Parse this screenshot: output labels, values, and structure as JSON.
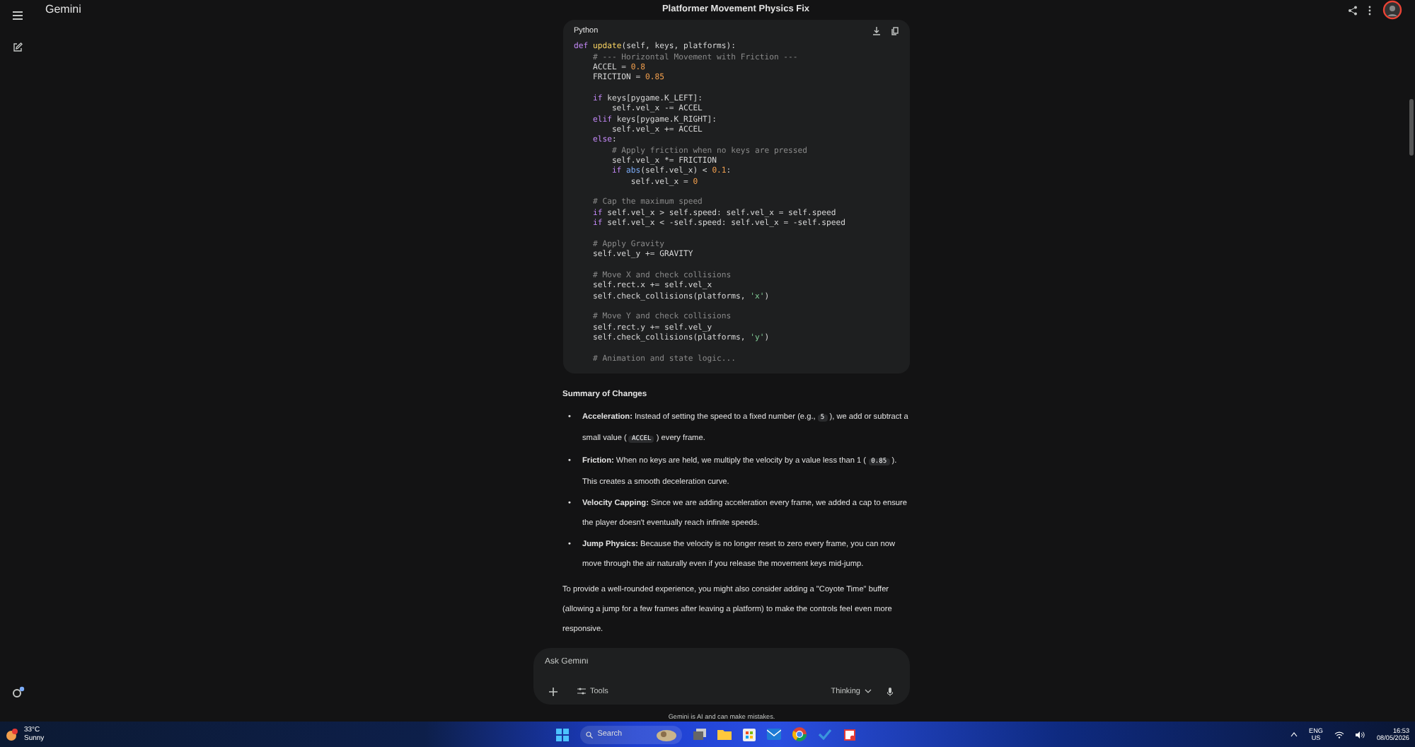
{
  "app": {
    "name": "Gemini"
  },
  "conversation": {
    "title": "Platformer Movement Physics Fix"
  },
  "code_block": {
    "language": "Python",
    "lines": [
      {
        "kind": "code",
        "tokens": [
          {
            "kind": "kw",
            "text": "def "
          },
          {
            "kind": "fn",
            "text": "update"
          },
          {
            "kind": "plain",
            "text": "(self, keys, platforms):"
          }
        ]
      },
      {
        "kind": "code",
        "tokens": [
          {
            "kind": "cm",
            "text": "    # --- Horizontal Movement with Friction ---"
          }
        ]
      },
      {
        "kind": "code",
        "tokens": [
          {
            "kind": "plain",
            "text": "    ACCEL = "
          },
          {
            "kind": "num",
            "text": "0.8"
          }
        ]
      },
      {
        "kind": "code",
        "tokens": [
          {
            "kind": "plain",
            "text": "    FRICTION = "
          },
          {
            "kind": "num",
            "text": "0.85"
          }
        ]
      },
      {
        "kind": "blank"
      },
      {
        "kind": "code",
        "tokens": [
          {
            "kind": "kw",
            "text": "    if"
          },
          {
            "kind": "plain",
            "text": " keys[pygame.K_LEFT]:"
          }
        ]
      },
      {
        "kind": "code",
        "tokens": [
          {
            "kind": "plain",
            "text": "        self.vel_x -= ACCEL"
          }
        ]
      },
      {
        "kind": "code",
        "tokens": [
          {
            "kind": "kw",
            "text": "    elif"
          },
          {
            "kind": "plain",
            "text": " keys[pygame.K_RIGHT]:"
          }
        ]
      },
      {
        "kind": "code",
        "tokens": [
          {
            "kind": "plain",
            "text": "        self.vel_x += ACCEL"
          }
        ]
      },
      {
        "kind": "code",
        "tokens": [
          {
            "kind": "kw",
            "text": "    else"
          },
          {
            "kind": "plain",
            "text": ":"
          }
        ]
      },
      {
        "kind": "code",
        "tokens": [
          {
            "kind": "cm",
            "text": "        # Apply friction when no keys are pressed"
          }
        ]
      },
      {
        "kind": "code",
        "tokens": [
          {
            "kind": "plain",
            "text": "        self.vel_x *= FRICTION"
          }
        ]
      },
      {
        "kind": "code",
        "tokens": [
          {
            "kind": "kw",
            "text": "        if "
          },
          {
            "kind": "bi",
            "text": "abs"
          },
          {
            "kind": "plain",
            "text": "(self.vel_x) < "
          },
          {
            "kind": "num",
            "text": "0.1"
          },
          {
            "kind": "plain",
            "text": ":"
          }
        ]
      },
      {
        "kind": "code",
        "tokens": [
          {
            "kind": "plain",
            "text": "            self.vel_x = "
          },
          {
            "kind": "num",
            "text": "0"
          }
        ]
      },
      {
        "kind": "blank"
      },
      {
        "kind": "code",
        "tokens": [
          {
            "kind": "cm",
            "text": "    # Cap the maximum speed"
          }
        ]
      },
      {
        "kind": "code",
        "tokens": [
          {
            "kind": "kw",
            "text": "    if"
          },
          {
            "kind": "plain",
            "text": " self.vel_x > self.speed: self.vel_x = self.speed"
          }
        ]
      },
      {
        "kind": "code",
        "tokens": [
          {
            "kind": "kw",
            "text": "    if"
          },
          {
            "kind": "plain",
            "text": " self.vel_x < -self.speed: self.vel_x = -self.speed"
          }
        ]
      },
      {
        "kind": "blank"
      },
      {
        "kind": "code",
        "tokens": [
          {
            "kind": "cm",
            "text": "    # Apply Gravity"
          }
        ]
      },
      {
        "kind": "code",
        "tokens": [
          {
            "kind": "plain",
            "text": "    self.vel_y += GRAVITY"
          }
        ]
      },
      {
        "kind": "blank"
      },
      {
        "kind": "code",
        "tokens": [
          {
            "kind": "cm",
            "text": "    # Move X and check collisions"
          }
        ]
      },
      {
        "kind": "code",
        "tokens": [
          {
            "kind": "plain",
            "text": "    self.rect.x += self.vel_x"
          }
        ]
      },
      {
        "kind": "code",
        "tokens": [
          {
            "kind": "plain",
            "text": "    self.check_collisions(platforms, "
          },
          {
            "kind": "str",
            "text": "'x'"
          },
          {
            "kind": "plain",
            "text": ")"
          }
        ]
      },
      {
        "kind": "blank"
      },
      {
        "kind": "code",
        "tokens": [
          {
            "kind": "cm",
            "text": "    # Move Y and check collisions"
          }
        ]
      },
      {
        "kind": "code",
        "tokens": [
          {
            "kind": "plain",
            "text": "    self.rect.y += self.vel_y"
          }
        ]
      },
      {
        "kind": "code",
        "tokens": [
          {
            "kind": "plain",
            "text": "    self.check_collisions(platforms, "
          },
          {
            "kind": "str",
            "text": "'y'"
          },
          {
            "kind": "plain",
            "text": ")"
          }
        ]
      },
      {
        "kind": "blank"
      },
      {
        "kind": "code",
        "tokens": [
          {
            "kind": "cm",
            "text": "    # Animation and state logic..."
          }
        ]
      }
    ]
  },
  "summary": {
    "heading": "Summary of Changes",
    "bullets": [
      {
        "marker": "•",
        "label": "Acceleration:",
        "parts": [
          {
            "kind": "text",
            "text": " Instead of setting the speed to a fixed number (e.g., "
          },
          {
            "kind": "code",
            "text": "5"
          },
          {
            "kind": "text",
            "text": "), we add or subtract a small value ("
          },
          {
            "kind": "code",
            "text": "ACCEL"
          },
          {
            "kind": "text",
            "text": ") every frame."
          }
        ]
      },
      {
        "marker": "•",
        "label": "Friction:",
        "parts": [
          {
            "kind": "text",
            "text": " When no keys are held, we multiply the velocity by a value less than 1 ("
          },
          {
            "kind": "code",
            "text": "0.85"
          },
          {
            "kind": "text",
            "text": "). This creates a smooth deceleration curve."
          }
        ]
      },
      {
        "marker": "•",
        "label": "Velocity Capping:",
        "parts": [
          {
            "kind": "text",
            "text": " Since we are adding acceleration every frame, we added a cap to ensure the player doesn't eventually reach infinite speeds."
          }
        ]
      },
      {
        "marker": "•",
        "label": "Jump Physics:",
        "parts": [
          {
            "kind": "text",
            "text": " Because the velocity is no longer reset to zero every frame, you can now move through the air naturally even if you release the movement keys mid-jump."
          }
        ]
      }
    ],
    "closing": "To provide a well-rounded experience, you might also consider adding a \"Coyote Time\" buffer (allowing a jump for a few frames after leaving a platform) to make the controls feel even more responsive."
  },
  "prompt": {
    "placeholder": "Ask Gemini",
    "tools_label": "Tools",
    "mode": "Thinking"
  },
  "disclaimer": "Gemini is AI and can make mistakes.",
  "taskbar": {
    "temperature": "33°C",
    "weather": "Sunny",
    "search_placeholder": "Search",
    "language": "ENG",
    "region": "US",
    "time": "16:53",
    "date": "08/05/2026"
  }
}
